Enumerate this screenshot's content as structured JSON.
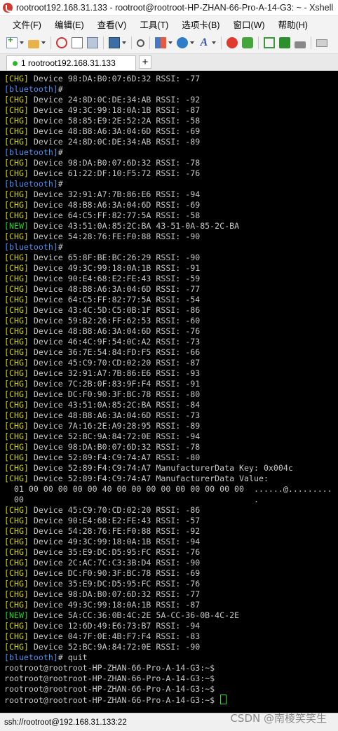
{
  "window": {
    "title": "rootroot192.168.31.133 - rootroot@rootroot-HP-ZHAN-66-Pro-A-14-G3: ~ - Xshell"
  },
  "menu": [
    "文件(F)",
    "编辑(E)",
    "查看(V)",
    "工具(T)",
    "选项卡(B)",
    "窗口(W)",
    "帮助(H)"
  ],
  "tab": {
    "label": "1 rootroot192.168.31.133",
    "add_label": "+"
  },
  "colors": {
    "chg": "#d4d400",
    "new": "#26d426",
    "prompt_bt": "#4d8ff0",
    "text": "#c8c8c8"
  },
  "terminal_lines": [
    {
      "tag": "CHG",
      "text": " Device 98:DA:B0:07:6D:32 RSSI: -77"
    },
    {
      "tag": "BT",
      "text": "#"
    },
    {
      "tag": "CHG",
      "text": " Device 24:8D:0C:DE:34:AB RSSI: -92"
    },
    {
      "tag": "CHG",
      "text": " Device 49:3C:99:18:0A:1B RSSI: -87"
    },
    {
      "tag": "CHG",
      "text": " Device 58:85:E9:2E:52:2A RSSI: -58"
    },
    {
      "tag": "CHG",
      "text": " Device 48:B8:A6:3A:04:6D RSSI: -69"
    },
    {
      "tag": "CHG",
      "text": " Device 24:8D:0C:DE:34:AB RSSI: -89"
    },
    {
      "tag": "BT",
      "text": "#"
    },
    {
      "tag": "CHG",
      "text": " Device 98:DA:B0:07:6D:32 RSSI: -78"
    },
    {
      "tag": "CHG",
      "text": " Device 61:22:DF:10:F5:72 RSSI: -76"
    },
    {
      "tag": "BT",
      "text": "#"
    },
    {
      "tag": "CHG",
      "text": " Device 32:91:A7:7B:86:E6 RSSI: -94"
    },
    {
      "tag": "CHG",
      "text": " Device 48:B8:A6:3A:04:6D RSSI: -69"
    },
    {
      "tag": "CHG",
      "text": " Device 64:C5:FF:82:77:5A RSSI: -58"
    },
    {
      "tag": "NEW",
      "text": " Device 43:51:0A:85:2C:BA 43-51-0A-85-2C-BA"
    },
    {
      "tag": "CHG",
      "text": " Device 54:28:76:FE:F0:88 RSSI: -90"
    },
    {
      "tag": "BT",
      "text": "#"
    },
    {
      "tag": "CHG",
      "text": " Device 65:8F:BE:BC:26:29 RSSI: -90"
    },
    {
      "tag": "CHG",
      "text": " Device 49:3C:99:18:0A:1B RSSI: -91"
    },
    {
      "tag": "CHG",
      "text": " Device 90:E4:68:E2:FE:43 RSSI: -59"
    },
    {
      "tag": "CHG",
      "text": " Device 48:B8:A6:3A:04:6D RSSI: -77"
    },
    {
      "tag": "CHG",
      "text": " Device 64:C5:FF:82:77:5A RSSI: -54"
    },
    {
      "tag": "CHG",
      "text": " Device 43:4C:5D:C5:0B:1F RSSI: -86"
    },
    {
      "tag": "CHG",
      "text": " Device 59:B2:26:FF:62:53 RSSI: -60"
    },
    {
      "tag": "CHG",
      "text": " Device 48:B8:A6:3A:04:6D RSSI: -76"
    },
    {
      "tag": "CHG",
      "text": " Device 46:4C:9F:54:0C:A2 RSSI: -73"
    },
    {
      "tag": "CHG",
      "text": " Device 36:7E:54:84:FD:F5 RSSI: -66"
    },
    {
      "tag": "CHG",
      "text": " Device 45:C9:70:CD:02:20 RSSI: -87"
    },
    {
      "tag": "CHG",
      "text": " Device 32:91:A7:7B:86:E6 RSSI: -93"
    },
    {
      "tag": "CHG",
      "text": " Device 7C:2B:0F:83:9F:F4 RSSI: -91"
    },
    {
      "tag": "CHG",
      "text": " Device DC:F0:90:3F:BC:78 RSSI: -80"
    },
    {
      "tag": "CHG",
      "text": " Device 43:51:0A:85:2C:BA RSSI: -84"
    },
    {
      "tag": "CHG",
      "text": " Device 48:B8:A6:3A:04:6D RSSI: -73"
    },
    {
      "tag": "CHG",
      "text": " Device 7A:16:2E:A9:28:95 RSSI: -89"
    },
    {
      "tag": "CHG",
      "text": " Device 52:BC:9A:84:72:0E RSSI: -94"
    },
    {
      "tag": "CHG",
      "text": " Device 98:DA:B0:07:6D:32 RSSI: -78"
    },
    {
      "tag": "CHG",
      "text": " Device 52:89:F4:C9:74:A7 RSSI: -80"
    },
    {
      "tag": "CHG",
      "text": " Device 52:89:F4:C9:74:A7 ManufacturerData Key: 0x004c"
    },
    {
      "tag": "CHG",
      "text": " Device 52:89:F4:C9:74:A7 ManufacturerData Value:"
    },
    {
      "tag": "",
      "text": "  01 00 00 00 00 00 40 00 00 00 00 00 00 00 00 00  ......@........."
    },
    {
      "tag": "",
      "text": "  00                                               ."
    },
    {
      "tag": "CHG",
      "text": " Device 45:C9:70:CD:02:20 RSSI: -86"
    },
    {
      "tag": "CHG",
      "text": " Device 90:E4:68:E2:FE:43 RSSI: -57"
    },
    {
      "tag": "CHG",
      "text": " Device 54:28:76:FE:F0:88 RSSI: -92"
    },
    {
      "tag": "CHG",
      "text": " Device 49:3C:99:18:0A:1B RSSI: -94"
    },
    {
      "tag": "CHG",
      "text": " Device 35:E9:DC:D5:95:FC RSSI: -76"
    },
    {
      "tag": "CHG",
      "text": " Device 2C:AC:7C:C3:3B:D4 RSSI: -90"
    },
    {
      "tag": "CHG",
      "text": " Device DC:F0:90:3F:BC:78 RSSI: -69"
    },
    {
      "tag": "CHG",
      "text": " Device 35:E9:DC:D5:95:FC RSSI: -76"
    },
    {
      "tag": "CHG",
      "text": " Device 98:DA:B0:07:6D:32 RSSI: -77"
    },
    {
      "tag": "CHG",
      "text": " Device 49:3C:99:18:0A:1B RSSI: -87"
    },
    {
      "tag": "NEW",
      "text": " Device 5A:CC:36:0B:4C:2E 5A-CC-36-0B-4C-2E"
    },
    {
      "tag": "CHG",
      "text": " Device 12:6D:49:E6:73:B7 RSSI: -94"
    },
    {
      "tag": "CHG",
      "text": " Device 04:7F:0E:4B:F7:F4 RSSI: -83"
    },
    {
      "tag": "CHG",
      "text": " Device 52:BC:9A:84:72:0E RSSI: -90"
    },
    {
      "tag": "BT",
      "text": "# quit"
    },
    {
      "tag": "",
      "text": "rootroot@rootroot-HP-ZHAN-66-Pro-A-14-G3:~$"
    },
    {
      "tag": "",
      "text": "rootroot@rootroot-HP-ZHAN-66-Pro-A-14-G3:~$"
    },
    {
      "tag": "",
      "text": "rootroot@rootroot-HP-ZHAN-66-Pro-A-14-G3:~$"
    },
    {
      "tag": "",
      "text": "rootroot@rootroot-HP-ZHAN-66-Pro-A-14-G3:~$ ",
      "cursor": true
    }
  ],
  "tag_labels": {
    "CHG": "[CHG]",
    "NEW": "[NEW]",
    "BT": "[bluetooth]"
  },
  "status": {
    "connection": "ssh://rootroot@192.168.31.133:22"
  },
  "watermark": "CSDN @南棱笑笑生"
}
